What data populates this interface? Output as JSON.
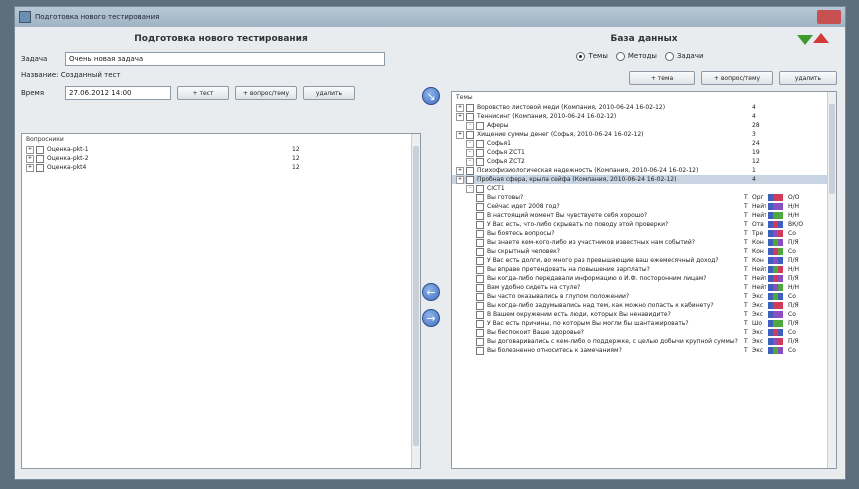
{
  "window": {
    "title": "Подготовка нового тестирования"
  },
  "left": {
    "heading": "Подготовка нового тестирования",
    "task_label": "Задача",
    "task_value": "Очень новая задача",
    "subtitle": "Название: Созданный тест",
    "time_label": "Время",
    "time_value": "27.06.2012 14:00",
    "buttons": [
      "+ тест",
      "+ вопрос/тему",
      "удалить"
    ],
    "panel_title": "Вопросники",
    "items": [
      {
        "label": "Оценка-pkt-1",
        "count": "12"
      },
      {
        "label": "Оценка-pkt-2",
        "count": "12"
      },
      {
        "label": "Оценка-pkt4",
        "count": "12"
      }
    ]
  },
  "right": {
    "heading": "База данных",
    "radios": [
      {
        "label": "Темы",
        "selected": true
      },
      {
        "label": "Методы",
        "selected": false
      },
      {
        "label": "Задачи",
        "selected": false
      }
    ],
    "buttons": [
      "+ тема",
      "+ вопрос/тему",
      "удалить"
    ],
    "panel_title": "Темы",
    "tree": [
      {
        "label": "Воровство листовой меди (Компания, 2010-06-24 16-02-12)",
        "count": "4",
        "level": 0
      },
      {
        "label": "Теннисинг (Компания, 2010-06-24 16-02-12)",
        "count": "4",
        "level": 0
      },
      {
        "label": "Аферы",
        "count": "28",
        "level": 1
      },
      {
        "label": "Хищение суммы денег (Софья, 2010-06-24 16-02-12)",
        "count": "3",
        "level": 0
      },
      {
        "label": "Софья1",
        "count": "24",
        "level": 1
      },
      {
        "label": "Софья ZCT1",
        "count": "19",
        "level": 1
      },
      {
        "label": "Софья ZCT2",
        "count": "12",
        "level": 1
      },
      {
        "label": "Психофизиологическая надежность (Компания, 2010-06-24 16-02-12)",
        "count": "1",
        "level": 0
      },
      {
        "label": "Пробная сфера, крыла сейфа (Компания, 2010-06-24 16-02-12)",
        "count": "4",
        "level": 0
      },
      {
        "label": "CICT1",
        "count": "",
        "level": 1
      }
    ],
    "questions": [
      {
        "text": "Вы готовы?",
        "t": "T",
        "code": "Орг",
        "tag": "О/О"
      },
      {
        "text": "Сейчас идет 2008 год?",
        "t": "T",
        "code": "Нейт",
        "tag": "Н/Н"
      },
      {
        "text": "В настоящий момент Вы чувствуете себя хорошо?",
        "t": "T",
        "code": "Нейт",
        "tag": "Н/Н"
      },
      {
        "text": "У Вас есть, что-либо скрывать по поводу этой проверки?",
        "t": "T",
        "code": "Отв",
        "tag": "ВК/О"
      },
      {
        "text": "Вы боятесь вопросы?",
        "t": "T",
        "code": "Тре",
        "tag": "Со"
      },
      {
        "text": "Вы знаете кем-кого-либо из участников известных нам событий?",
        "t": "T",
        "code": "Кон",
        "tag": "П/Я"
      },
      {
        "text": "Вы скрытный человек?",
        "t": "T",
        "code": "Кон",
        "tag": "Со"
      },
      {
        "text": "У Вас есть долги, во много раз превышающие ваш ежемесячный доход?",
        "t": "T",
        "code": "Кон",
        "tag": "П/Я"
      },
      {
        "text": "Вы вправе претендовать на повышение зарплаты?",
        "t": "T",
        "code": "Нейт",
        "tag": "Н/Н"
      },
      {
        "text": "Вы когда-либо передавали информацию о И.Ф. посторонним лицам?",
        "t": "T",
        "code": "Нейт",
        "tag": "П/Я"
      },
      {
        "text": "Вам удобно сидеть на стуле?",
        "t": "T",
        "code": "Нейт",
        "tag": "Н/Н"
      },
      {
        "text": "Вы часто оказывались в глупом положении?",
        "t": "T",
        "code": "Экс",
        "tag": "Со"
      },
      {
        "text": "Вы когда-либо задумывались над тем, как можно попасть к кабинету?",
        "t": "T",
        "code": "Экс",
        "tag": "П/Я"
      },
      {
        "text": "В Вашем окружении есть люди, которых Вы ненавидите?",
        "t": "T",
        "code": "Экс",
        "tag": "Со"
      },
      {
        "text": "У Вас есть причины, по которым Вы могли бы шантажировать?",
        "t": "T",
        "code": "Шо",
        "tag": "П/Я"
      },
      {
        "text": "Вы беспокоит Ваше здоровье?",
        "t": "T",
        "code": "Экс",
        "tag": "Со"
      },
      {
        "text": "Вы договаривались с кем-либо о поддержке, с целью добычи крупной суммы?",
        "t": "T",
        "code": "Экс",
        "tag": "П/Я"
      },
      {
        "text": "Вы болезненно относитесь к замечаниям?",
        "t": "T",
        "code": "Экс",
        "tag": "Со"
      }
    ]
  },
  "colors": {
    "swatch_blue": "#3f5fbf",
    "swatch_red": "#d23a5a",
    "swatch_purple": "#8a4fbf",
    "swatch_green": "#4fa83e",
    "arrow_green": "#3e9a2e",
    "arrow_red": "#d23a3a"
  }
}
